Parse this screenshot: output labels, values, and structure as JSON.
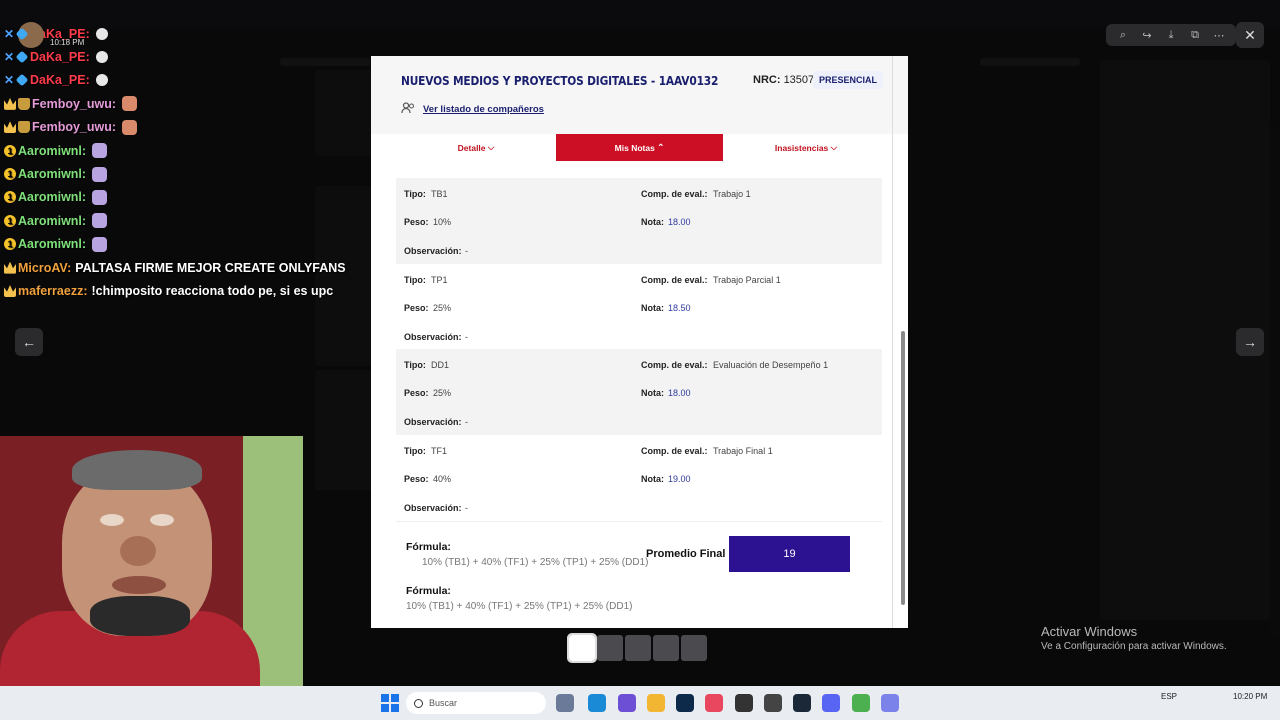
{
  "chat": {
    "timestamp": "10:18 PM",
    "messages": [
      {
        "user": "DaKa_PE:",
        "color": "#ff3b4a",
        "badges": [
          "sword",
          "cube"
        ],
        "text": "",
        "emote": "skull"
      },
      {
        "user": "DaKa_PE:",
        "color": "#ff3b4a",
        "badges": [
          "sword",
          "cube"
        ],
        "text": "",
        "emote": "skull"
      },
      {
        "user": "DaKa_PE:",
        "color": "#ff3b4a",
        "badges": [
          "sword",
          "cube"
        ],
        "text": "",
        "emote": "skull"
      },
      {
        "user": "Femboy_uwu:",
        "color": "#e59ad9",
        "badges": [
          "crown",
          "cake"
        ],
        "text": "",
        "emote": "monkey"
      },
      {
        "user": "Femboy_uwu:",
        "color": "#e59ad9",
        "badges": [
          "crown",
          "cake"
        ],
        "text": "",
        "emote": "monkey"
      },
      {
        "user": "Aaromiwnl:",
        "color": "#7fe07a",
        "badges": [
          "num"
        ],
        "text": "",
        "emote": "robot"
      },
      {
        "user": "Aaromiwnl:",
        "color": "#7fe07a",
        "badges": [
          "num"
        ],
        "text": "",
        "emote": "robot"
      },
      {
        "user": "Aaromiwnl:",
        "color": "#7fe07a",
        "badges": [
          "num"
        ],
        "text": "",
        "emote": "robot"
      },
      {
        "user": "Aaromiwnl:",
        "color": "#7fe07a",
        "badges": [
          "num"
        ],
        "text": "",
        "emote": "robot"
      },
      {
        "user": "Aaromiwnl:",
        "color": "#7fe07a",
        "badges": [
          "num"
        ],
        "text": "",
        "emote": "robot"
      },
      {
        "user": "MicroAV:",
        "color": "#f0a13c",
        "badges": [
          "crown"
        ],
        "text": "PALTASA FIRME MEJOR CREATE ONLYFANS",
        "emote": ""
      },
      {
        "user": "maferraezz:",
        "color": "#f0a13c",
        "badges": [
          "crown"
        ],
        "text": "!chimposito reacciona todo pe, si es upc",
        "emote": ""
      }
    ]
  },
  "course": {
    "title": "NUEVOS MEDIOS Y PROYECTOS DIGITALES - 1AAV0132",
    "nrc_label": "NRC:",
    "nrc_value": "13507",
    "modality": "PRESENCIAL",
    "classmates_link": "Ver listado de compañeros"
  },
  "tabs": [
    {
      "label": "Detalle",
      "active": false
    },
    {
      "label": "Mis Notas",
      "active": true
    },
    {
      "label": "Inasistencias",
      "active": false
    }
  ],
  "labels": {
    "tipo": "Tipo:",
    "peso": "Peso:",
    "observacion": "Observación:",
    "comp": "Comp. de eval.:",
    "nota": "Nota:",
    "formula": "Fórmula:",
    "promedio": "Promedio Final"
  },
  "grades": [
    {
      "tipo": "TB1",
      "peso": "10%",
      "comp": "Trabajo 1",
      "nota": "18.00",
      "obs": "-"
    },
    {
      "tipo": "TP1",
      "peso": "25%",
      "comp": "Trabajo Parcial 1",
      "nota": "18.50",
      "obs": "-"
    },
    {
      "tipo": "DD1",
      "peso": "25%",
      "comp": "Evaluación de Desempeño 1",
      "nota": "18.00",
      "obs": "-"
    },
    {
      "tipo": "TF1",
      "peso": "40%",
      "comp": "Trabajo Final 1",
      "nota": "19.00",
      "obs": "-"
    }
  ],
  "formula": "10% (TB1) + 40% (TF1) + 25% (TP1) + 25% (DD1)",
  "promedio_final": "19",
  "watermark": {
    "title": "Activar Windows",
    "subtitle": "Ve a Configuración para activar Windows."
  },
  "taskbar": {
    "search_placeholder": "Buscar",
    "lang": "ESP",
    "time": "10:20 PM"
  },
  "colors": {
    "tab_active": "#cc0f24",
    "promedio_box": "#2c1290",
    "nota_text": "#2f3a9e"
  }
}
